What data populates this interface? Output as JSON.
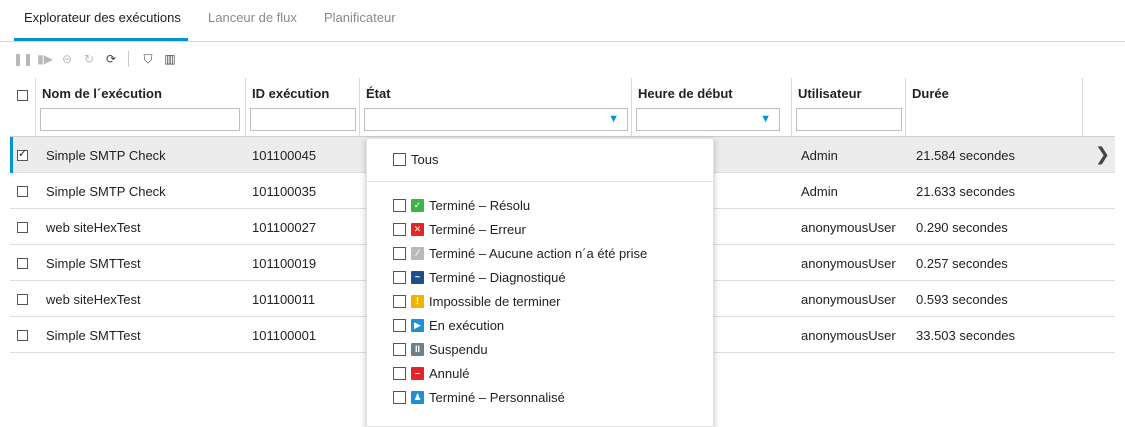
{
  "tabs": [
    {
      "label": "Explorateur des exécutions"
    },
    {
      "label": "Lanceur de flux"
    },
    {
      "label": "Planificateur"
    }
  ],
  "toolbar": {
    "icons": [
      "pause-icon",
      "resume-icon",
      "cancel-icon",
      "reassign-icon",
      "refresh-icon",
      "filter-icon",
      "columns-icon"
    ]
  },
  "table": {
    "columns": [
      {
        "title": "Nom de l´exécution"
      },
      {
        "title": "ID exécution"
      },
      {
        "title": "État"
      },
      {
        "title": "Heure de début"
      },
      {
        "title": "Utilisateur"
      },
      {
        "title": "Durée"
      }
    ],
    "rows": [
      {
        "name": "Simple SMTP Check",
        "id": "101100045",
        "user": "Admin",
        "duration": "21.584 secondes",
        "checked": true
      },
      {
        "name": "Simple SMTP Check",
        "id": "101100035",
        "user": "Admin",
        "duration": "21.633 secondes",
        "checked": false
      },
      {
        "name": "web siteHexTest",
        "id": "101100027",
        "user": "anonymousUser",
        "duration": "0.290 secondes",
        "checked": false
      },
      {
        "name": "Simple SMTTest",
        "id": "101100019",
        "user": "anonymousUser",
        "duration": "0.257 secondes",
        "checked": false
      },
      {
        "name": "web siteHexTest",
        "id": "101100011",
        "user": "anonymousUser",
        "duration": "0.593 secondes",
        "checked": false
      },
      {
        "name": "Simple SMTTest",
        "id": "101100001",
        "user": "anonymousUser",
        "duration": "33.503 secondes",
        "checked": false
      }
    ]
  },
  "state_dropdown": {
    "all_label": "Tous",
    "options": [
      {
        "label": "Terminé – Résolu",
        "icon": "resolved-icon",
        "color": "#3cb44a",
        "glyph": "✓"
      },
      {
        "label": "Terminé – Erreur",
        "icon": "error-icon",
        "color": "#e0262b",
        "glyph": "✕"
      },
      {
        "label": "Terminé – Aucune action n´a été prise",
        "icon": "no-action-icon",
        "color": "#b9b9b9",
        "glyph": "∕"
      },
      {
        "label": "Terminé – Diagnostiqué",
        "icon": "diagnosed-icon",
        "color": "#1f4e8c",
        "glyph": "~"
      },
      {
        "label": "Impossible de terminer",
        "icon": "warning-icon",
        "color": "#f0b400",
        "glyph": "!"
      },
      {
        "label": "En exécution",
        "icon": "running-icon",
        "color": "#1e90d6",
        "glyph": "▶"
      },
      {
        "label": "Suspendu",
        "icon": "paused-icon",
        "color": "#6f7f8c",
        "glyph": "II"
      },
      {
        "label": "Annulé",
        "icon": "canceled-icon",
        "color": "#e0262b",
        "glyph": "–"
      },
      {
        "label": "Terminé – Personnalisé",
        "icon": "custom-icon",
        "color": "#1e90d6",
        "glyph": "♟"
      }
    ]
  },
  "colors": {
    "accent": "#0096d6"
  }
}
